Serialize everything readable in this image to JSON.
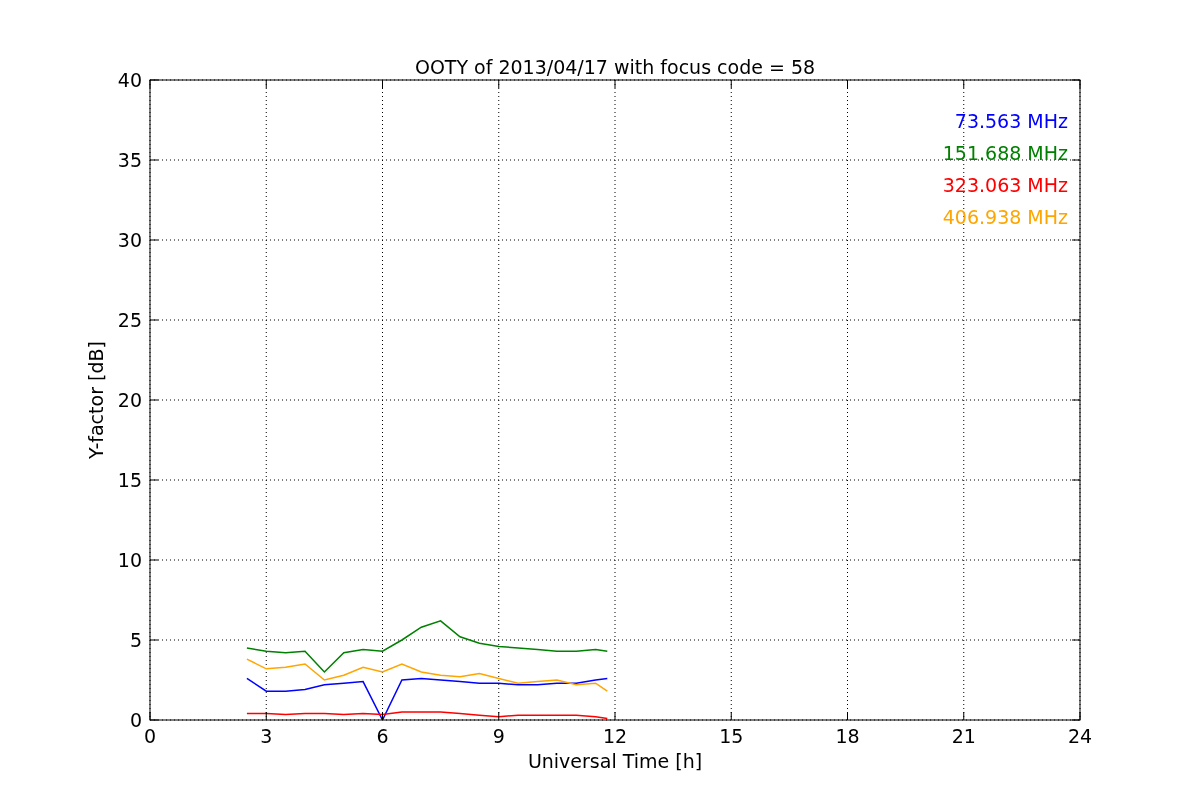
{
  "chart_data": {
    "type": "line",
    "title": "OOTY of 2013/04/17 with focus code = 58",
    "xlabel": "Universal Time [h]",
    "ylabel": "Y-factor [dB]",
    "x": [
      2.5,
      3,
      3.5,
      4,
      4.5,
      5,
      5.5,
      6,
      6.5,
      7,
      7.5,
      8,
      8.5,
      9,
      9.5,
      10,
      10.5,
      11,
      11.5,
      11.8
    ],
    "series": [
      {
        "name": "73.563 MHz",
        "color": "#0000ff",
        "values": [
          2.6,
          1.8,
          1.8,
          1.9,
          2.2,
          2.3,
          2.4,
          0,
          2.5,
          2.6,
          2.5,
          2.4,
          2.3,
          2.3,
          2.2,
          2.2,
          2.3,
          2.3,
          2.5,
          2.6
        ]
      },
      {
        "name": "151.688 MHz",
        "color": "#008000",
        "values": [
          4.5,
          4.3,
          4.2,
          4.3,
          3.0,
          4.2,
          4.4,
          4.3,
          5.0,
          5.8,
          6.2,
          5.2,
          4.8,
          4.6,
          4.5,
          4.4,
          4.3,
          4.3,
          4.4,
          4.3
        ]
      },
      {
        "name": "323.063 MHz",
        "color": "#ff0000",
        "values": [
          0.4,
          0.4,
          0.35,
          0.4,
          0.4,
          0.35,
          0.4,
          0.35,
          0.5,
          0.5,
          0.5,
          0.4,
          0.3,
          0.2,
          0.3,
          0.3,
          0.3,
          0.3,
          0.2,
          0.1
        ]
      },
      {
        "name": "406.938 MHz",
        "color": "#ffa500",
        "values": [
          3.8,
          3.2,
          3.3,
          3.5,
          2.5,
          2.8,
          3.3,
          3.0,
          3.5,
          3.0,
          2.8,
          2.7,
          2.9,
          2.6,
          2.3,
          2.4,
          2.5,
          2.2,
          2.3,
          1.8
        ]
      }
    ],
    "grid": true,
    "xlim": [
      0,
      24
    ],
    "ylim": [
      0,
      40
    ],
    "xticks": [
      0,
      3,
      6,
      9,
      12,
      15,
      18,
      21,
      24
    ],
    "yticks": [
      0,
      5,
      10,
      15,
      20,
      25,
      30,
      35,
      40
    ]
  }
}
